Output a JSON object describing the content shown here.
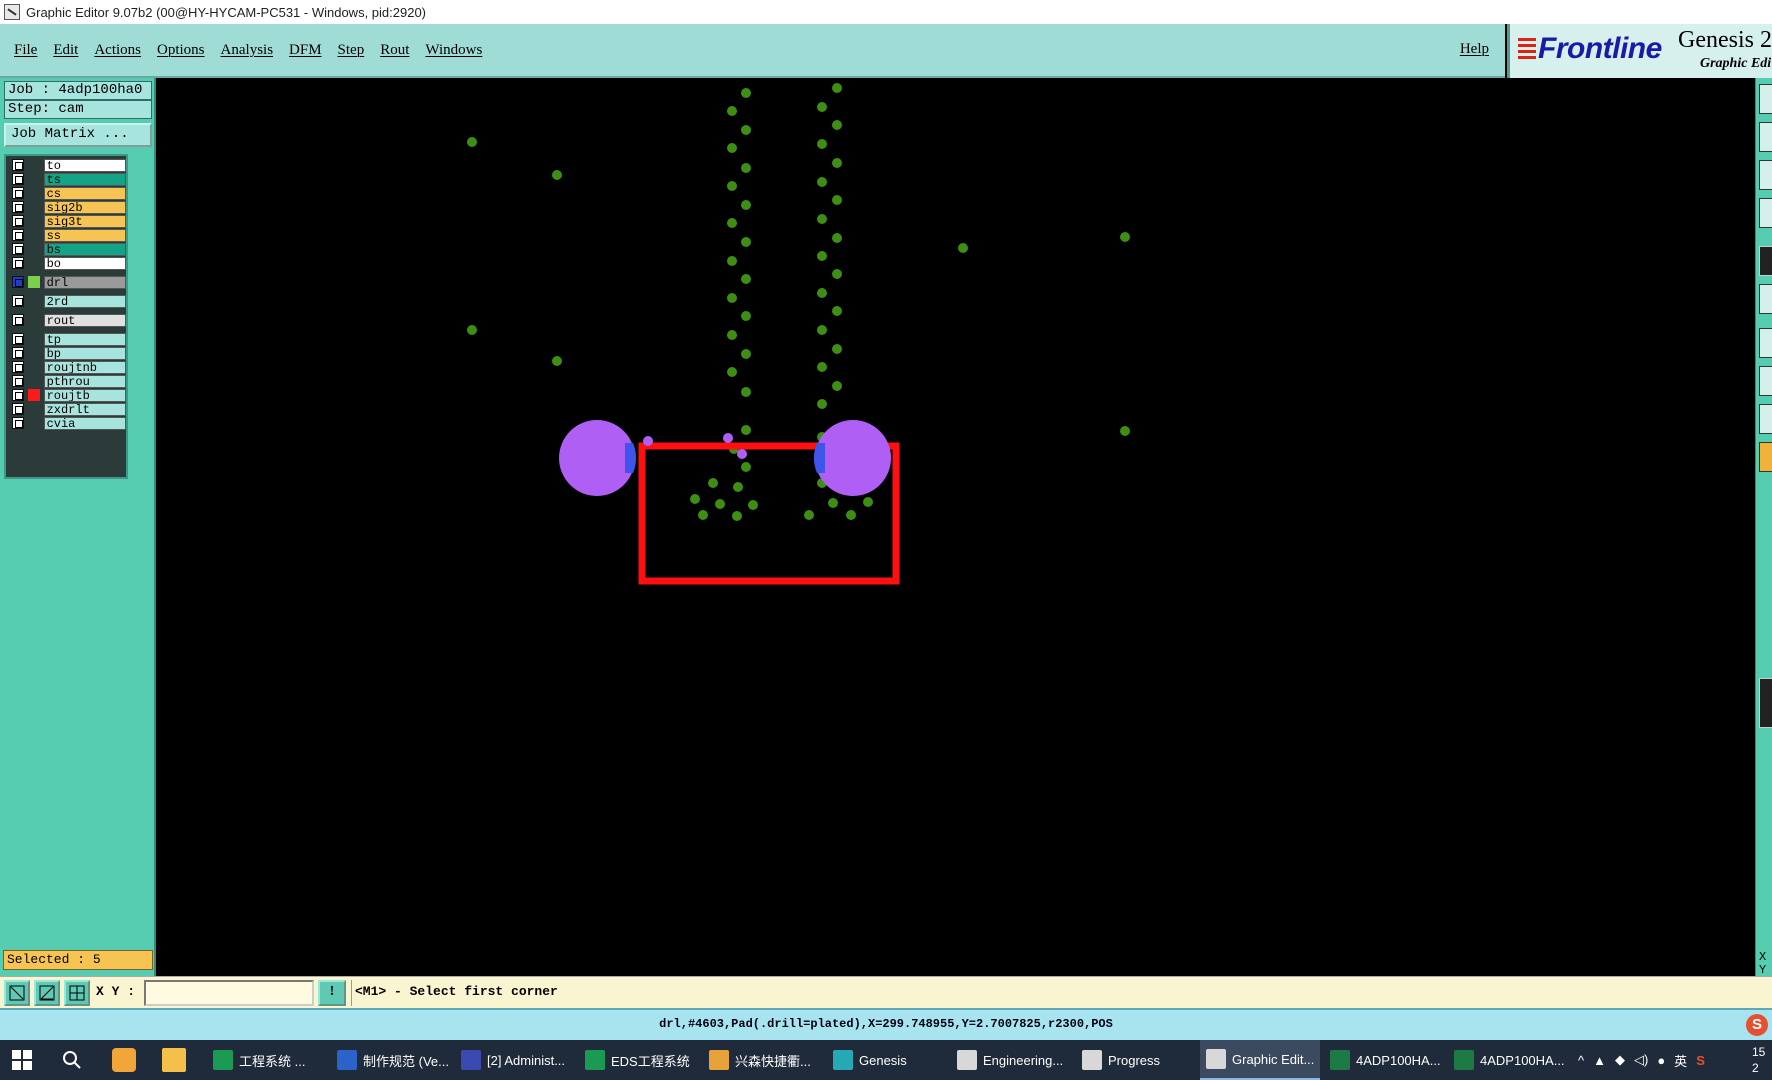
{
  "window": {
    "title": "Graphic Editor 9.07b2 (00@HY-HYCAM-PC531 - Windows, pid:2920)"
  },
  "menu": {
    "items": [
      "File",
      "Edit",
      "Actions",
      "Options",
      "Analysis",
      "DFM",
      "Step",
      "Rout",
      "Windows"
    ],
    "help": "Help"
  },
  "brand": {
    "logo": "Frontline",
    "title": "Genesis 2",
    "subtitle": "Graphic Edi"
  },
  "panel": {
    "job": "Job  : 4adp100ha0",
    "step": "Step: cam",
    "job_matrix": "Job Matrix ...",
    "selected": "Selected : 5"
  },
  "layers": [
    {
      "name": "to",
      "color": "#ffffff",
      "flag": ""
    },
    {
      "name": "ts",
      "color": "#13a386",
      "flag": ""
    },
    {
      "name": "cs",
      "color": "#f6c453",
      "flag": ""
    },
    {
      "name": "sig2b",
      "color": "#f6c453",
      "flag": ""
    },
    {
      "name": "sig3t",
      "color": "#f6c453",
      "flag": ""
    },
    {
      "name": "ss",
      "color": "#f6c453",
      "flag": ""
    },
    {
      "name": "bs",
      "color": "#13a386",
      "flag": ""
    },
    {
      "name": "bo",
      "color": "#ffffff",
      "flag": ""
    },
    {
      "name": "drl",
      "color": "#9a9a9a",
      "flag": "work",
      "active": true
    },
    {
      "name": "2rd",
      "color": "#a8e4de",
      "flag": ""
    },
    {
      "name": "rout",
      "color": "#e0e0e0",
      "flag": ""
    },
    {
      "name": "tp",
      "color": "#a8e4de",
      "flag": ""
    },
    {
      "name": "bp",
      "color": "#a8e4de",
      "flag": ""
    },
    {
      "name": "roujtnb",
      "color": "#a8e4de",
      "flag": ""
    },
    {
      "name": "pthrou",
      "color": "#a8e4de",
      "flag": ""
    },
    {
      "name": "roujtb",
      "color": "#a8e4de",
      "flag": "red"
    },
    {
      "name": "zxdrlt",
      "color": "#a8e4de",
      "flag": ""
    },
    {
      "name": "cvia",
      "color": "#a8e4de",
      "flag": ""
    }
  ],
  "canvas": {
    "background": "#000000",
    "pad_color": "#3e8e14",
    "selected_color": "#b05ff5",
    "selection_rect_color": "#ff1010"
  },
  "right_strip": {
    "x_label": "X",
    "y_label": "Y"
  },
  "command": {
    "xy_label": "X Y :",
    "xy_value": "",
    "info_button": "!",
    "prompt": "<M1> - Select first corner"
  },
  "status": {
    "text": "drl,#4603,Pad(.drill=plated),X=299.748955,Y=2.7007825,r2300,POS"
  },
  "taskbar": {
    "items": [
      {
        "label": "工程系统   ...",
        "icon": "p-app-icon",
        "color": "#1a9a52"
      },
      {
        "label": "制作规范 (Ve...",
        "icon": "document-icon",
        "color": "#2a64c8"
      },
      {
        "label": "[2] Administ...",
        "icon": "floppy-icon",
        "color": "#3a4ab0"
      },
      {
        "label": "EDS工程系统",
        "icon": "f-app-icon",
        "color": "#1a9a52"
      },
      {
        "label": "兴森快捷衢...",
        "icon": "chat-icon",
        "color": "#e7a23a"
      },
      {
        "label": "Genesis",
        "icon": "genesis-icon",
        "color": "#27a8b5"
      },
      {
        "label": "Engineering...",
        "icon": "graphic-window-icon",
        "color": "#d8d8d8"
      },
      {
        "label": "Progress",
        "icon": "graphic-window-icon",
        "color": "#d8d8d8"
      },
      {
        "label": "Graphic Edit...",
        "icon": "graphic-window-icon",
        "color": "#d8d8d8",
        "active": true
      },
      {
        "label": "4ADP100HA...",
        "icon": "excel-icon",
        "color": "#1d7a45"
      },
      {
        "label": "4ADP100HA...",
        "icon": "excel-icon",
        "color": "#1d7a45"
      }
    ],
    "tray_ime": "英",
    "clock_line1": "15",
    "clock_line2": "2"
  }
}
